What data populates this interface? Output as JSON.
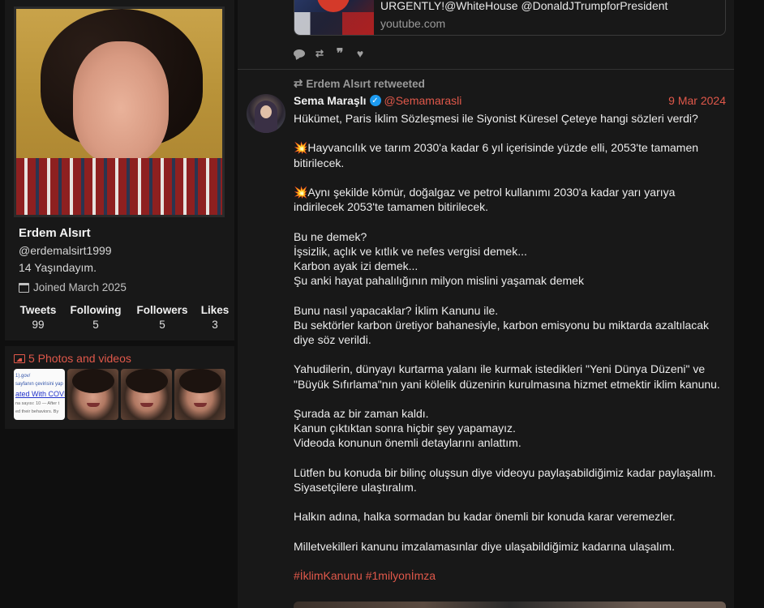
{
  "profile": {
    "display_name": "Erdem Alsırt",
    "username": "@erdemalsirt1999",
    "bio": "14 Yaşındayım.",
    "joined": "Joined March 2025",
    "stats": [
      {
        "label": "Tweets",
        "value": "99"
      },
      {
        "label": "Following",
        "value": "5"
      },
      {
        "label": "Followers",
        "value": "5"
      },
      {
        "label": "Likes",
        "value": "3"
      }
    ]
  },
  "media": {
    "title": "5 Photos and videos",
    "doc_thumb_lines": [
      "1).gov/",
      "sayfanın çevirisini yap",
      "ated With COVID",
      "na sayısı: 10 — After t",
      "ed their behaviors. By"
    ]
  },
  "prev_tweet": {
    "link_title": "URGENTLY!@WhiteHouse @DonaldJTrumpforPresident",
    "link_domain": "youtube.com"
  },
  "tweet": {
    "retweet_line": "Erdem Alsırt retweeted",
    "author_name": "Sema Maraşlı",
    "author_handle": "@Semamarasli",
    "date": "9 Mar 2024",
    "paragraphs": [
      [
        "Hükümet, Paris İklim Sözleşmesi ile Siyonist Küresel Çeteye hangi sözleri verdi?"
      ],
      [
        "💥Hayvancılık ve tarım 2030'a kadar 6 yıl içerisinde yüzde elli, 2053'te tamamen bitirilecek."
      ],
      [
        "💥Aynı şekilde kömür, doğalgaz ve petrol kullanımı 2030'a kadar yarı yarıya indirilecek 2053'te tamamen bitirilecek."
      ],
      [
        "Bu ne demek?",
        "İşsizlik, açlık ve kıtlık ve nefes vergisi demek...",
        "Karbon ayak izi demek...",
        "Şu anki hayat pahalılığının milyon mislini yaşamak demek"
      ],
      [
        "Bunu nasıl yapacaklar? İklim Kanunu ile.",
        "Bu sektörler karbon üretiyor bahanesiyle, karbon emisyonu bu miktarda azaltılacak diye söz verildi."
      ],
      [
        "Yahudilerin, dünyayı kurtarma yalanı ile kurmak istedikleri \"Yeni Dünya Düzeni\" ve \"Büyük Sıfırlama\"nın yani kölelik düzenirin kurulmasına hizmet etmektir iklim kanunu."
      ],
      [
        "Şurada az bir zaman kaldı.",
        "Kanun çıktıktan sonra hiçbir şey yapamayız.",
        "Videoda konunun önemli detaylarını anlattım."
      ],
      [
        "Lütfen bu konuda bir bilinç oluşsun diye videoyu paylaşabildiğimiz kadar paylaşalım. Siyasetçilere ulaştıralım."
      ],
      [
        "Halkın adına, halka sormadan bu kadar önemli bir konuda karar veremezler."
      ],
      [
        "Milletvekilleri kanunu imzalamasınlar diye ulaşabildiğimiz kadarına ulaşalım."
      ]
    ],
    "hashtags": "#İklimKanunu #1milyonİmza"
  },
  "icons": {
    "reply": "reply-icon",
    "retweet": "retweet-icon",
    "quote": "quote-icon",
    "like": "heart-icon"
  },
  "colors": {
    "accent": "#e0584a",
    "verified": "#1d9bf0"
  }
}
